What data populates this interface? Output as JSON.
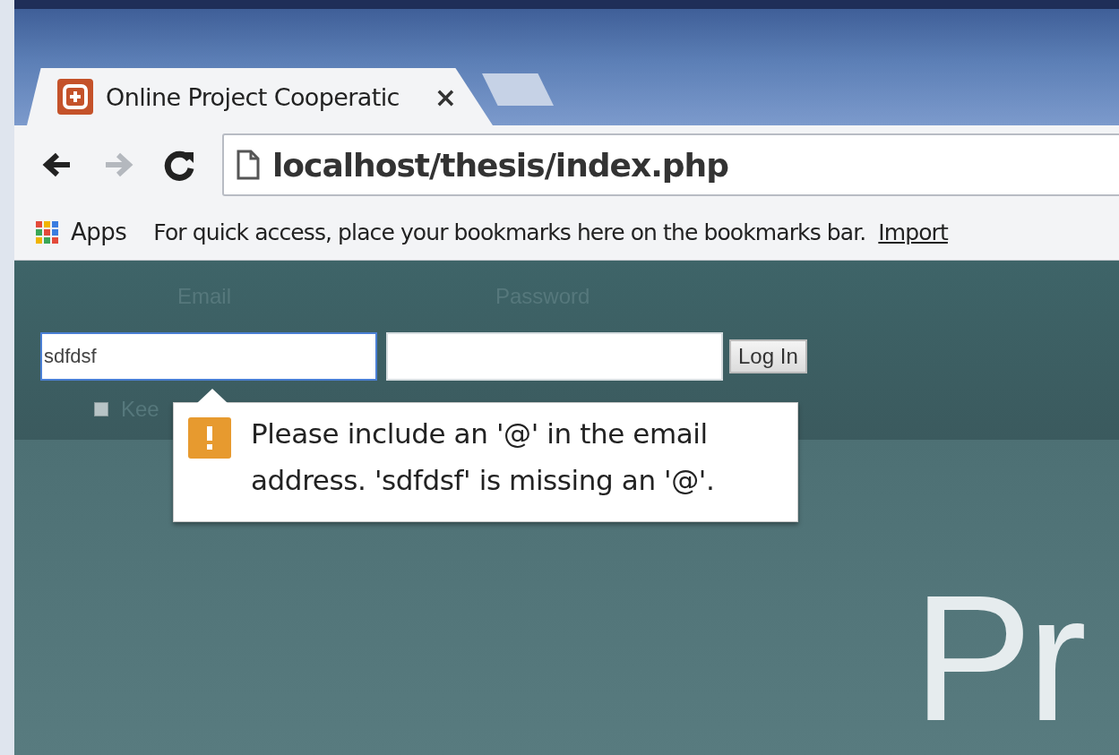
{
  "browser": {
    "tabs": [
      {
        "title": "Online Project Cooperatic",
        "close": "×",
        "selected": true
      }
    ],
    "back": {
      "disabled": false
    },
    "forward": {
      "disabled": true
    },
    "url": "localhost/thesis/index.php",
    "bookmarks_bar": {
      "apps_label": "Apps",
      "message": "For quick access, place your bookmarks here on the bookmarks bar.",
      "import_link": "Import"
    }
  },
  "page": {
    "login": {
      "email_label": "Email",
      "email_value": "sdfdsf",
      "email_focused": true,
      "password_label": "Password",
      "login_button": "Log In",
      "remember": {
        "label": "Kee",
        "checked": false
      }
    },
    "validation": {
      "message": "Please include an '@' in the email address. 'sdfdsf' is missing an '@'."
    },
    "hero_text": "Pr"
  }
}
